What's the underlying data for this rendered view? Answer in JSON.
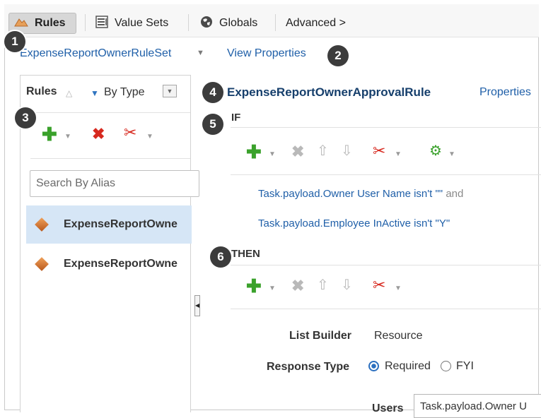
{
  "tabs": {
    "rules": "Rules",
    "value_sets": "Value Sets",
    "globals": "Globals",
    "advanced": "Advanced >"
  },
  "ruleset": {
    "name": "ExpenseReportOwnerRuleSet",
    "view_properties": "View Properties"
  },
  "left_panel": {
    "title": "Rules",
    "sort_by": "By Type",
    "search_placeholder": "Search By Alias",
    "items": [
      {
        "label": "ExpenseReportOwne",
        "selected": true
      },
      {
        "label": "ExpenseReportOwne",
        "selected": false
      }
    ]
  },
  "rule": {
    "name": "ExpenseReportOwnerApprovalRule",
    "properties_link": "Properties",
    "if_label": "IF",
    "conditions": [
      {
        "field": "Task.payload.Owner User Name",
        "op": "isn't",
        "value": "\"\"",
        "conj": "and"
      },
      {
        "field": "Task.payload.Employee InActive",
        "op": "isn't",
        "value": "\"Y\"",
        "conj": ""
      }
    ],
    "then_label": "THEN",
    "list_builder_label": "List Builder",
    "list_builder_value": "Resource",
    "response_type_label": "Response Type",
    "response_required": "Required",
    "response_fyi": "FYI",
    "response_selected": "Required",
    "users_label": "Users",
    "users_value": "Task.payload.Owner U"
  },
  "callouts": [
    "1",
    "2",
    "3",
    "4",
    "5",
    "6"
  ],
  "colors": {
    "link": "#1f5fa8",
    "title": "#163f6c",
    "selected_row": "#d6e6f6",
    "add_green": "#3aa12b",
    "delete_red": "#d7291f",
    "badge": "#3c3c3c"
  },
  "icons": {
    "rules_tab": "rules-icon",
    "value_sets_tab": "value-sets-icon",
    "globals_tab": "globe-icon",
    "rule_item": "diamond-icon",
    "add": "plus-icon",
    "delete": "delete-icon",
    "cut": "scissors-icon",
    "move_up": "arrow-up-icon",
    "move_down": "arrow-down-icon",
    "advanced_settings": "gear-icon"
  }
}
